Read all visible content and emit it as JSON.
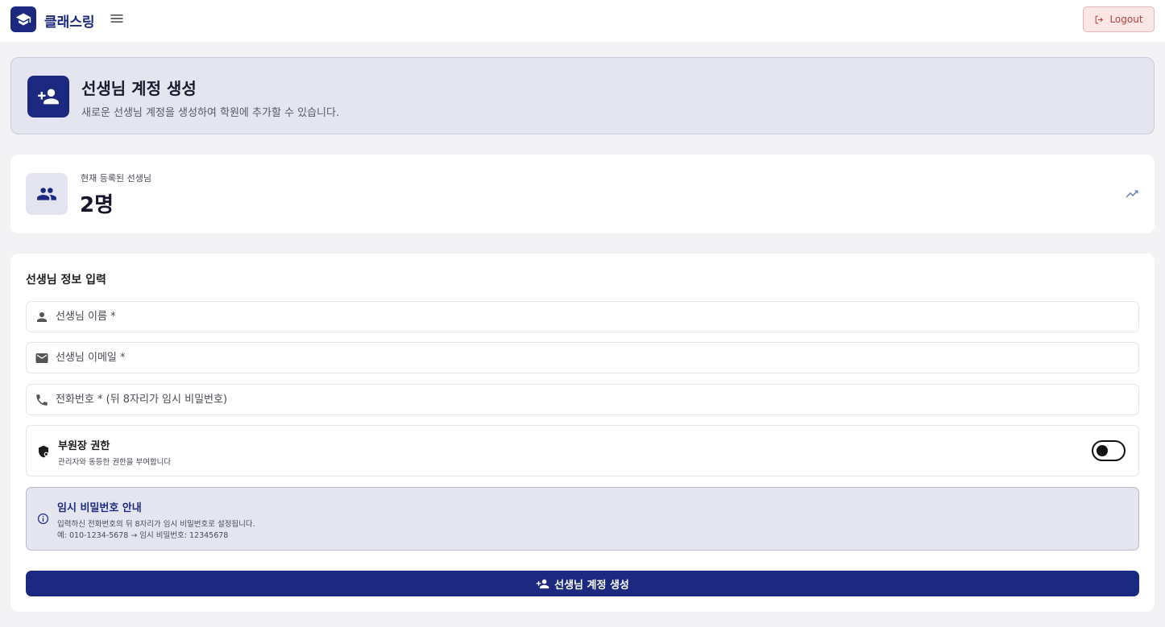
{
  "app": {
    "brand": "클래스링",
    "logout_label": "Logout"
  },
  "header": {
    "title": "선생님 계정 생성",
    "subtitle": "새로운 선생님 계정을 생성하여 학원에 추가할 수 있습니다."
  },
  "stats": {
    "label": "현재 등록된 선생님",
    "value": "2명"
  },
  "form": {
    "title": "선생님 정보 입력",
    "name_placeholder": "선생님 이름 *",
    "email_placeholder": "선생님 이메일 *",
    "phone_placeholder": "전화번호 * (뒤 8자리가 임시 비밀번호)",
    "role_toggle": {
      "title": "부원장 권한",
      "description": "관리자와 동등한 권한을 부여합니다"
    },
    "info": {
      "title": "임시 비밀번호 안내",
      "line1": "입력하신 전화번호의 뒤 8자리가 임시 비밀번호로 설정됩니다.",
      "line2": "예: 010-1234-5678 → 임시 비밀번호: 12345678"
    },
    "submit_label": "선생님 계정 생성"
  },
  "icons": {
    "logo": "school-icon",
    "menu": "menu-icon",
    "logout": "logout-icon",
    "header": "person-add-icon",
    "stats": "group-icon",
    "trend": "trending-up-icon",
    "name": "person-icon",
    "email": "mail-icon",
    "phone": "phone-icon",
    "role": "admin-shield-icon",
    "info": "info-icon",
    "submit": "person-add-icon"
  },
  "colors": {
    "primary": "#1b2a80",
    "logout_bg": "#fbe6e6",
    "logout_text": "#b94141",
    "page_bg": "#f3f3f5",
    "accent_bg": "#e4e5ef"
  }
}
